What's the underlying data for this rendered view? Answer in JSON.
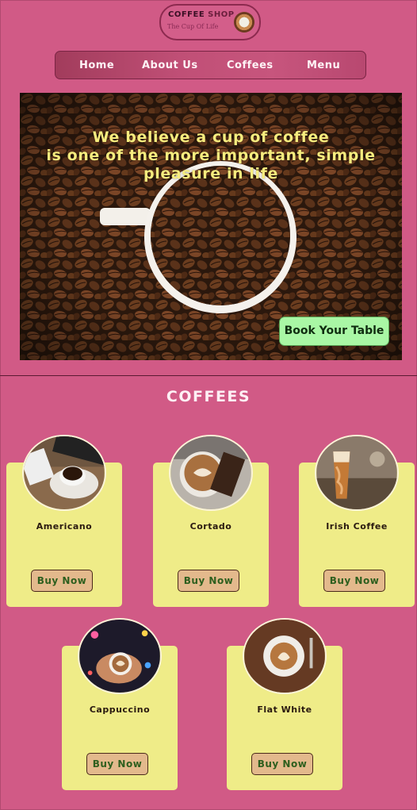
{
  "logo": {
    "title_part1": "COFFEE",
    "title_part2": "SHOP",
    "tagline": "The Cup Of Life"
  },
  "nav": {
    "items": [
      "Home",
      "About Us",
      "Coffees",
      "Menu"
    ]
  },
  "hero": {
    "headline_lines": [
      "We believe a cup of coffee",
      "is one of the more important, simple",
      "pleasure in life"
    ],
    "cta": "Book Your Table"
  },
  "section": {
    "title": "COFFEES"
  },
  "products": [
    {
      "name": "Americano",
      "button": "Buy Now"
    },
    {
      "name": "Cortado",
      "button": "Buy Now"
    },
    {
      "name": "Irish Coffee",
      "button": "Buy Now"
    },
    {
      "name": "Cappuccino",
      "button": "Buy Now"
    },
    {
      "name": "Flat White",
      "button": "Buy Now"
    }
  ],
  "colors": {
    "background": "#d15a86",
    "card": "#efec88",
    "accent": "#f6ec7e",
    "cta": "#a9f7a5",
    "button": "#e3b98c"
  }
}
